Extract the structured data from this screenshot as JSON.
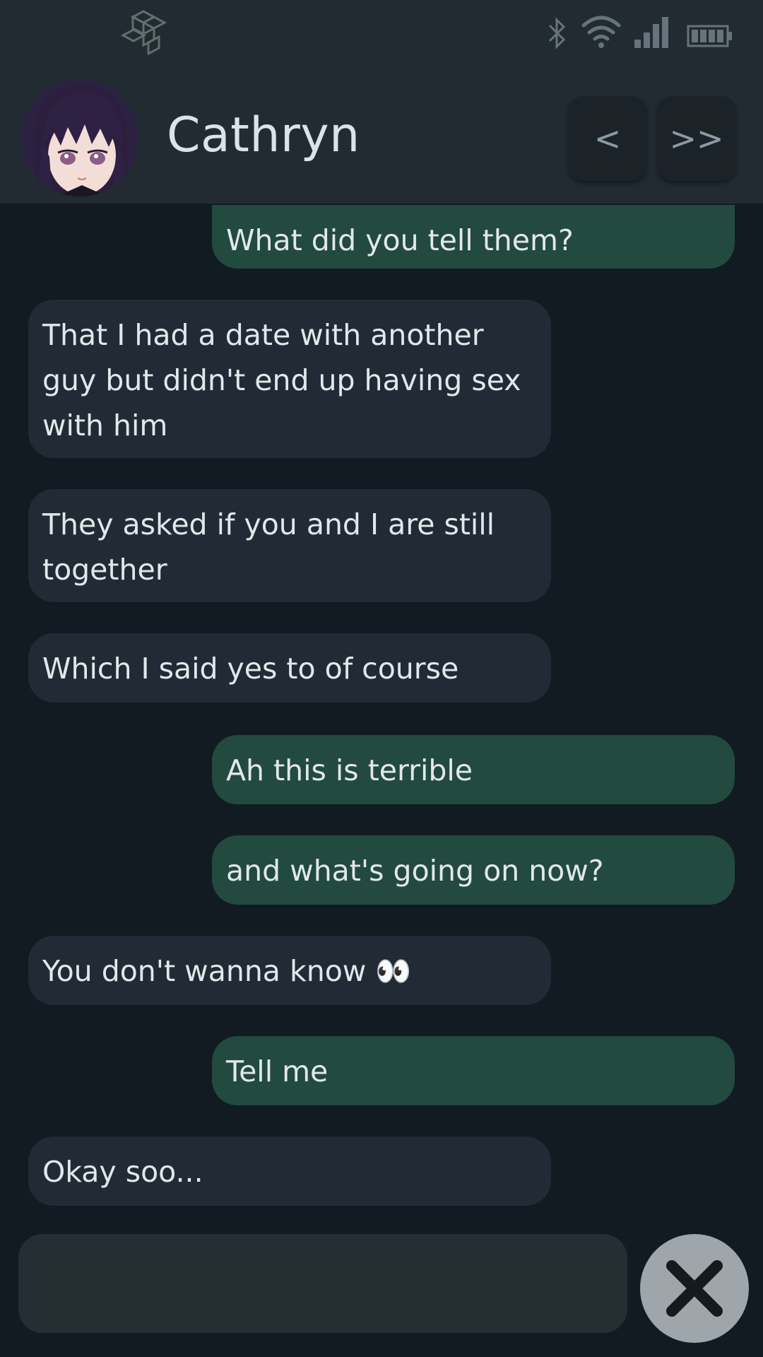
{
  "status_bar": {
    "icons": [
      "app-logo-icon",
      "bluetooth-icon",
      "wifi-icon",
      "cell-signal-icon",
      "battery-icon"
    ]
  },
  "header": {
    "contact_name": "Cathryn",
    "back_label": "<",
    "skip_label": ">>"
  },
  "messages": [
    {
      "from": "me",
      "text": "What did you tell them?"
    },
    {
      "from": "them",
      "text": "That I had a date with another guy but didn't end up having sex with him"
    },
    {
      "from": "them",
      "text": "They asked if you and I are still together"
    },
    {
      "from": "them",
      "text": "Which I said yes to of course"
    },
    {
      "from": "me",
      "text": "Ah this is terrible"
    },
    {
      "from": "me",
      "text": "and what's going on now?"
    },
    {
      "from": "them",
      "text": "You don't wanna know 👀"
    },
    {
      "from": "me",
      "text": "Tell me"
    },
    {
      "from": "them",
      "text": "Okay soo..."
    }
  ],
  "composer": {
    "value": "",
    "close_icon": "close-icon"
  },
  "colors": {
    "background": "#121b21",
    "header": "#222a32",
    "outgoing_bubble": "#224a3f",
    "incoming_bubble": "#222b35",
    "close_button": "#9ea6ab"
  }
}
